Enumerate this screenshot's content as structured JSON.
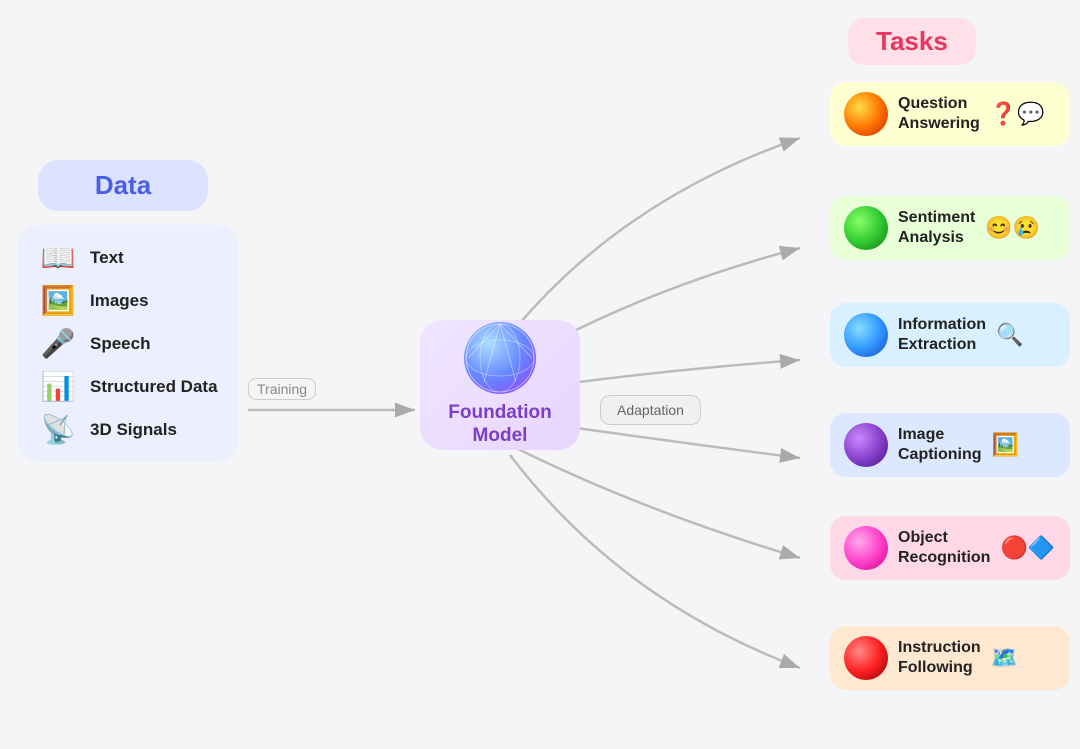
{
  "data_section": {
    "label": "Data",
    "items": [
      {
        "id": "text",
        "label": "Text",
        "icon": "📖"
      },
      {
        "id": "images",
        "label": "Images",
        "icon": "🖼️"
      },
      {
        "id": "speech",
        "label": "Speech",
        "icon": "🎤"
      },
      {
        "id": "structured_data",
        "label": "Structured Data",
        "icon": "📊"
      },
      {
        "id": "3d_signals",
        "label": "3D Signals",
        "icon": "📡"
      }
    ]
  },
  "training": {
    "label": "Training"
  },
  "foundation_model": {
    "label": "Foundation\nModel"
  },
  "adaptation": {
    "label": "Adaptation"
  },
  "tasks_section": {
    "title": "Tasks",
    "items": [
      {
        "id": "qa",
        "label": "Question\nAnswering",
        "emoji": "❓💬",
        "sphere_class": "sphere-qa"
      },
      {
        "id": "sa",
        "label": "Sentiment\nAnalysis",
        "emoji": "😊😢",
        "sphere_class": "sphere-sa"
      },
      {
        "id": "ie",
        "label": "Information\nExtraction",
        "emoji": "🔍",
        "sphere_class": "sphere-ie"
      },
      {
        "id": "ic",
        "label": "Image\nCaptioning",
        "emoji": "🖼️",
        "sphere_class": "sphere-ic"
      },
      {
        "id": "or",
        "label": "Object\nRecognition",
        "emoji": "🔴🔷",
        "sphere_class": "sphere-or"
      },
      {
        "id": "if",
        "label": "Instruction\nFollowing",
        "emoji": "🗺️",
        "sphere_class": "sphere-if"
      }
    ]
  }
}
